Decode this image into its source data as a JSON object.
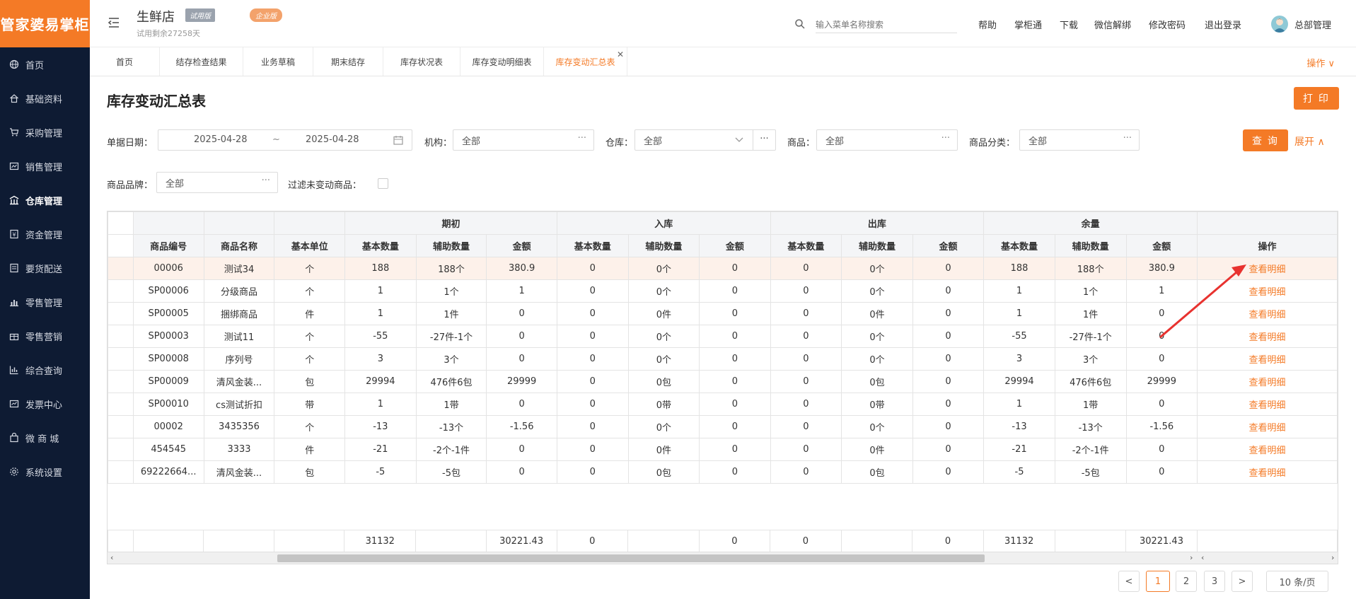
{
  "app": {
    "logo_text": "管家婆易掌柜"
  },
  "sidebar": {
    "items": [
      {
        "label": "首页",
        "icon": "globe-icon"
      },
      {
        "label": "基础资料",
        "icon": "home-icon"
      },
      {
        "label": "采购管理",
        "icon": "cart-icon"
      },
      {
        "label": "销售管理",
        "icon": "sales-icon"
      },
      {
        "label": "仓库管理",
        "icon": "warehouse-icon",
        "active": true
      },
      {
        "label": "资金管理",
        "icon": "money-icon"
      },
      {
        "label": "要货配送",
        "icon": "delivery-icon"
      },
      {
        "label": "零售管理",
        "icon": "retail-icon"
      },
      {
        "label": "零售营销",
        "icon": "gift-icon"
      },
      {
        "label": "综合查询",
        "icon": "chart-icon"
      },
      {
        "label": "发票中心",
        "icon": "invoice-icon"
      },
      {
        "label": "微 商 城",
        "icon": "shop-icon"
      },
      {
        "label": "系统设置",
        "icon": "settings-icon"
      }
    ]
  },
  "header": {
    "store_name": "生鲜店",
    "badge_trial": "试用版",
    "badge_enterprise": "企业版",
    "trial_remaining": "试用剩余27258天",
    "search_placeholder": "输入菜单名称搜索",
    "links": [
      "帮助",
      "掌柜通",
      "下载",
      "微信解绑",
      "修改密码",
      "退出登录"
    ],
    "user": "总部管理"
  },
  "tabs": [
    "首页",
    "结存检查结果",
    "业务草稿",
    "期末结存",
    "库存状况表",
    "库存变动明细表",
    "库存变动汇总表"
  ],
  "tabs_ops": "操作 ∨",
  "page": {
    "title": "库存变动汇总表",
    "print_label": "打 印",
    "query_label": "查 询",
    "expand_label": "展开 ∧"
  },
  "filters": {
    "date_label": "单据日期：",
    "date_from": "2025-04-28",
    "date_sep": "~",
    "date_to": "2025-04-28",
    "org_label": "机构：",
    "org_value": "全部",
    "warehouse_label": "仓库：",
    "warehouse_value": "全部",
    "product_label": "商品：",
    "product_value": "全部",
    "category_label": "商品分类：",
    "category_value": "全部",
    "brand_label": "商品品牌：",
    "brand_value": "全部",
    "filter_unchanged_label": "过滤未变动商品："
  },
  "table": {
    "group_headers": [
      "期初",
      "入库",
      "出库",
      "余量"
    ],
    "columns": [
      "商品编号",
      "商品名称",
      "基本单位",
      "基本数量",
      "辅助数量",
      "金额",
      "基本数量",
      "辅助数量",
      "金额",
      "基本数量",
      "辅助数量",
      "金额",
      "基本数量",
      "辅助数量",
      "金额",
      "操作"
    ],
    "action_label": "查看明细",
    "rows": [
      [
        "00006",
        "测试34",
        "个",
        "188",
        "188个",
        "380.9",
        "0",
        "0个",
        "0",
        "0",
        "0个",
        "0",
        "188",
        "188个",
        "380.9"
      ],
      [
        "SP00006",
        "分级商品",
        "个",
        "1",
        "1个",
        "1",
        "0",
        "0个",
        "0",
        "0",
        "0个",
        "0",
        "1",
        "1个",
        "1"
      ],
      [
        "SP00005",
        "捆绑商品",
        "件",
        "1",
        "1件",
        "0",
        "0",
        "0件",
        "0",
        "0",
        "0件",
        "0",
        "1",
        "1件",
        "0"
      ],
      [
        "SP00003",
        "测试11",
        "个",
        "-55",
        "-27件-1个",
        "0",
        "0",
        "0个",
        "0",
        "0",
        "0个",
        "0",
        "-55",
        "-27件-1个",
        "0"
      ],
      [
        "SP00008",
        "序列号",
        "个",
        "3",
        "3个",
        "0",
        "0",
        "0个",
        "0",
        "0",
        "0个",
        "0",
        "3",
        "3个",
        "0"
      ],
      [
        "SP00009",
        "清风金装...",
        "包",
        "29994",
        "476件6包",
        "29999",
        "0",
        "0包",
        "0",
        "0",
        "0包",
        "0",
        "29994",
        "476件6包",
        "29999"
      ],
      [
        "SP00010",
        "cs测试折扣",
        "带",
        "1",
        "1带",
        "0",
        "0",
        "0带",
        "0",
        "0",
        "0带",
        "0",
        "1",
        "1带",
        "0"
      ],
      [
        "00002",
        "3435356",
        "个",
        "-13",
        "-13个",
        "-1.56",
        "0",
        "0个",
        "0",
        "0",
        "0个",
        "0",
        "-13",
        "-13个",
        "-1.56"
      ],
      [
        "454545",
        "3333",
        "件",
        "-21",
        "-2个-1件",
        "0",
        "0",
        "0件",
        "0",
        "0",
        "0件",
        "0",
        "-21",
        "-2个-1件",
        "0"
      ],
      [
        "69222664...",
        "清风金装...",
        "包",
        "-5",
        "-5包",
        "0",
        "0",
        "0包",
        "0",
        "0",
        "0包",
        "0",
        "-5",
        "-5包",
        "0"
      ]
    ],
    "totals": [
      "",
      "",
      "",
      "31132",
      "",
      "30221.43",
      "0",
      "",
      "0",
      "0",
      "",
      "0",
      "31132",
      "",
      "30221.43",
      ""
    ]
  },
  "pagination": {
    "pages": [
      "1",
      "2",
      "3"
    ],
    "current": "1",
    "prev": "<",
    "next": ">",
    "page_size": "10 条/页"
  },
  "colors": {
    "accent": "#f47a26",
    "sidebar": "#0e1b33",
    "highlight_row": "#fdf1ea",
    "arrow": "#e8322f"
  }
}
